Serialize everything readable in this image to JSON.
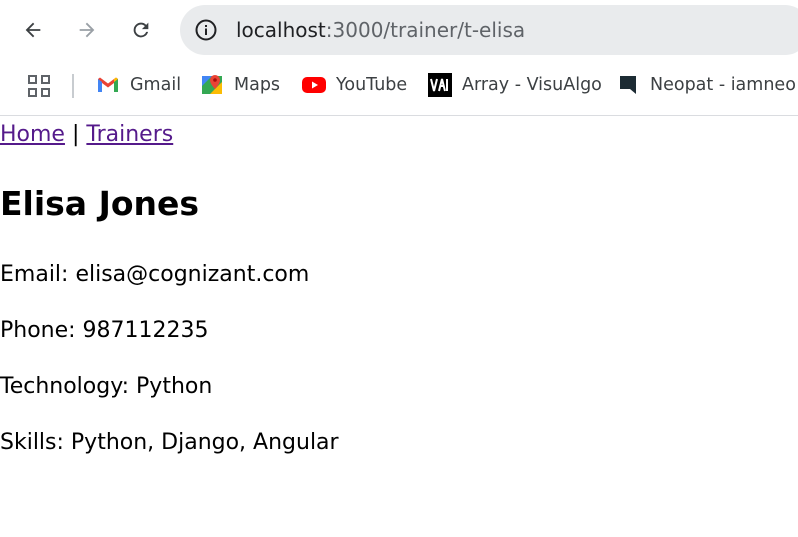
{
  "browser": {
    "url_host": "localhost",
    "url_path": ":3000/trainer/t-elisa",
    "bookmarks": [
      {
        "label": "Gmail",
        "icon": "gmail-icon"
      },
      {
        "label": "Maps",
        "icon": "maps-icon"
      },
      {
        "label": "YouTube",
        "icon": "youtube-icon"
      },
      {
        "label": "Array - VisuAlgo",
        "icon": "visualgo-icon"
      },
      {
        "label": "Neopat - iamneo",
        "icon": "neopat-icon"
      }
    ]
  },
  "nav": {
    "home": "Home",
    "separator": "|",
    "trainers": "Trainers"
  },
  "trainer": {
    "name": "Elisa Jones",
    "email": "Email: elisa@cognizant.com",
    "phone": "Phone: 987112235",
    "technology": "Technology: Python",
    "skills": "Skills: Python, Django, Angular"
  },
  "colors": {
    "link": "#551a8b",
    "omnibox": "#e9ebed",
    "youtube": "#ff0000"
  }
}
